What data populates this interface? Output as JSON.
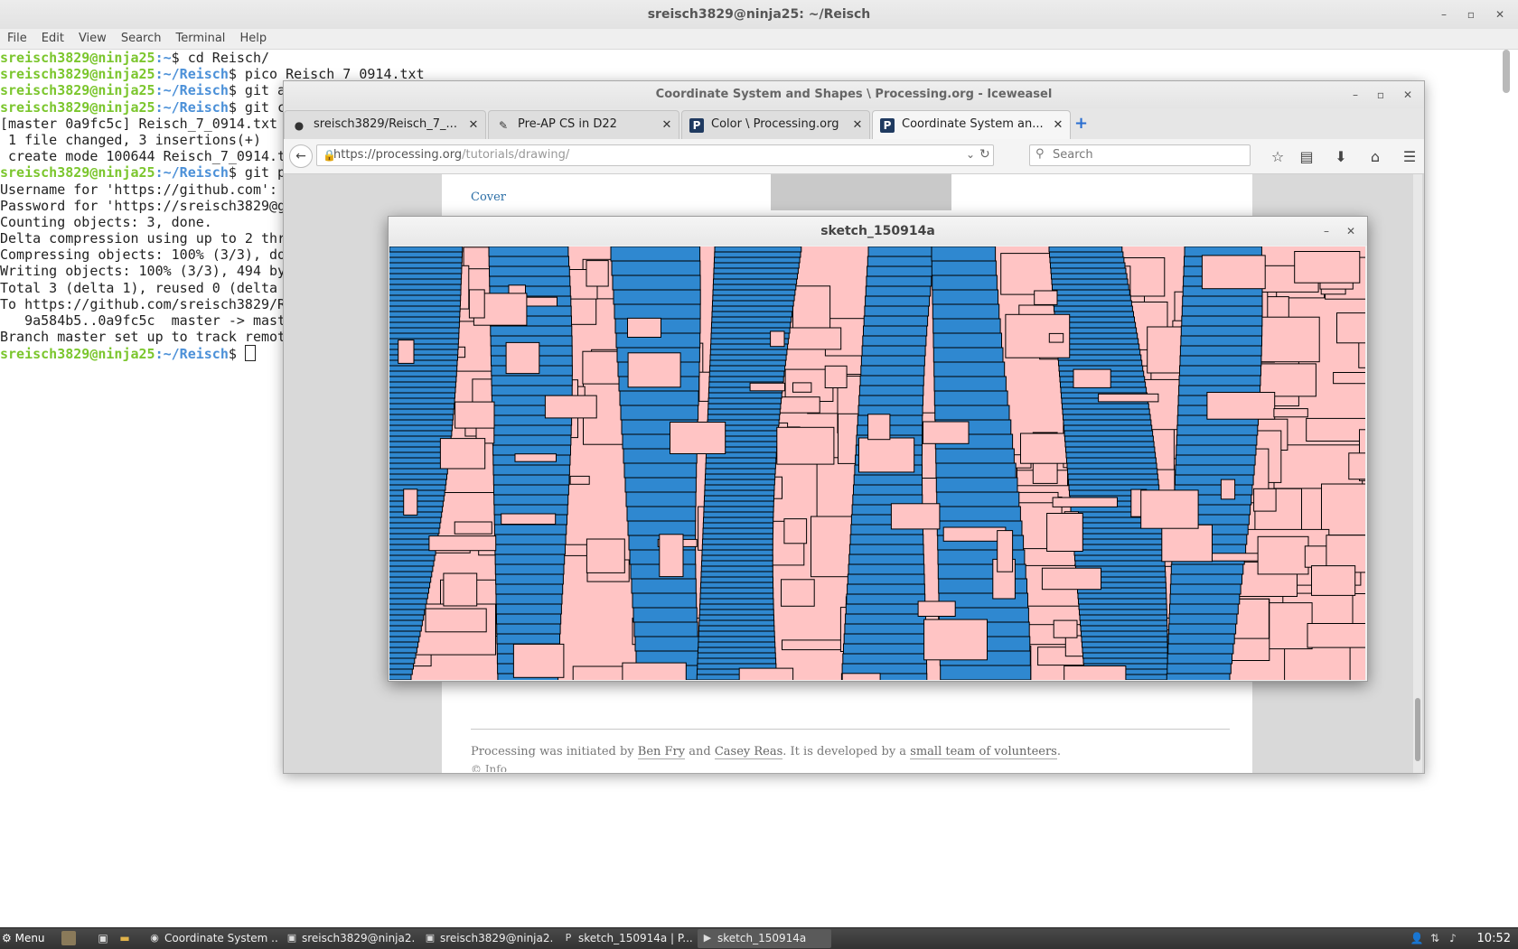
{
  "terminal": {
    "title": "sreisch3829@ninja25: ~/Reisch",
    "menu": [
      "File",
      "Edit",
      "View",
      "Search",
      "Terminal",
      "Help"
    ],
    "lines": [
      {
        "user": "sreisch3829@ninja25",
        "path": ":~",
        "cmd": "$ cd Reisch/"
      },
      {
        "user": "sreisch3829@ninja25",
        "path": ":~/Reisch",
        "cmd": "$ pico Reisch_7_0914.txt"
      },
      {
        "user": "sreisch3829@ninja25",
        "path": ":~/Reisch",
        "cmd": "$ git a"
      },
      {
        "user": "sreisch3829@ninja25",
        "path": ":~/Reisch",
        "cmd": "$ git c"
      },
      {
        "text": "[master 0a9fc5c] Reisch_7_0914.txt"
      },
      {
        "text": " 1 file changed, 3 insertions(+)"
      },
      {
        "text": " create mode 100644 Reisch_7_0914.t"
      },
      {
        "user": "sreisch3829@ninja25",
        "path": ":~/Reisch",
        "cmd": "$ git p"
      },
      {
        "text": "Username for 'https://github.com':"
      },
      {
        "text": "Password for 'https://sreisch3829@g"
      },
      {
        "text": "Counting objects: 3, done."
      },
      {
        "text": "Delta compression using up to 2 thr"
      },
      {
        "text": "Compressing objects: 100% (3/3), do"
      },
      {
        "text": "Writing objects: 100% (3/3), 494 by"
      },
      {
        "text": "Total 3 (delta 1), reused 0 (delta"
      },
      {
        "text": "To https://github.com/sreisch3829/R"
      },
      {
        "text": "   9a584b5..0a9fc5c  master -> mast"
      },
      {
        "text": "Branch master set up to track remot"
      },
      {
        "user": "sreisch3829@ninja25",
        "path": ":~/Reisch",
        "cmd": "$ ",
        "cursor": true
      }
    ]
  },
  "browser": {
    "title": "Coordinate System and Shapes \\ Processing.org - Iceweasel",
    "tabs": [
      {
        "label": "sreisch3829/Reisch_7_...",
        "icon": "github-icon"
      },
      {
        "label": "Pre-AP CS in D22",
        "icon": "pen-icon"
      },
      {
        "label": "Color \\ Processing.org",
        "icon": "processing-icon"
      },
      {
        "label": "Coordinate System an...",
        "icon": "processing-icon",
        "active": true
      }
    ],
    "url_host": "https://processing.org",
    "url_path": "/tutorials/drawing/",
    "search_placeholder": "Search",
    "cover_link": "Cover",
    "footer": {
      "t1": "Processing was initiated by ",
      "l1": "Ben Fry",
      "t2": " and ",
      "l2": "Casey Reas",
      "t3": ". It is developed by a ",
      "l3": "small team of volunteers",
      "t4": ".",
      "copyright": "© Info"
    }
  },
  "sketch": {
    "title": "sketch_150914a",
    "colors": {
      "background": "#ffc4c4",
      "blue": "#2f88d0",
      "stroke": "#000000"
    }
  },
  "taskbar": {
    "menu_label": "Menu",
    "items": [
      {
        "label": "Coordinate System ...",
        "icon": "iceweasel-icon"
      },
      {
        "label": "sreisch3829@ninja2...",
        "icon": "terminal-icon"
      },
      {
        "label": "sreisch3829@ninja2...",
        "icon": "terminal-icon"
      },
      {
        "label": "sketch_150914a | P...",
        "icon": "processing-icon"
      },
      {
        "label": "sketch_150914a",
        "icon": "play-icon",
        "active": true
      }
    ],
    "clock": "10:52"
  }
}
